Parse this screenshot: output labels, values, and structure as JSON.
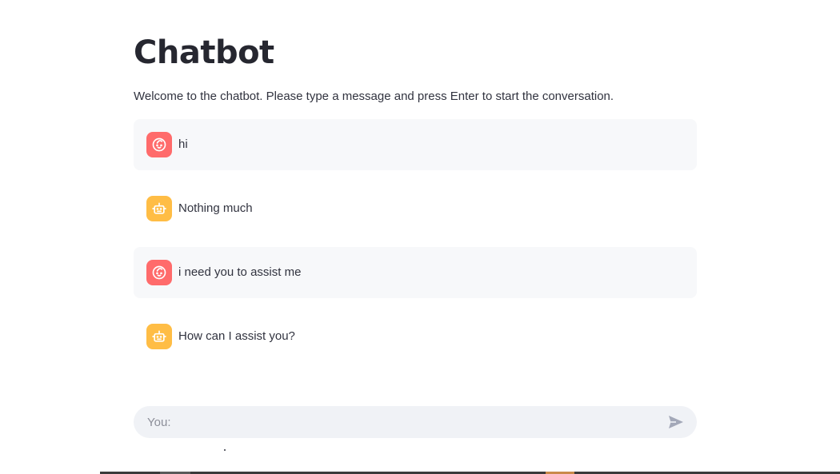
{
  "page": {
    "title": "Chatbot",
    "welcome": "Welcome to the chatbot. Please type a message and press Enter to start the conversation."
  },
  "messages": [
    {
      "role": "user",
      "text": "hi",
      "icon": "user-face-icon"
    },
    {
      "role": "assistant",
      "text": "Nothing much",
      "icon": "robot-icon"
    },
    {
      "role": "user",
      "text": "i need you to assist me",
      "icon": "user-face-icon"
    },
    {
      "role": "assistant",
      "text": "How can I assist you?",
      "icon": "robot-icon"
    }
  ],
  "chat_input": {
    "placeholder": "You:",
    "value": "",
    "send_icon": "send-icon"
  },
  "colors": {
    "user_avatar": "#ff6b6b",
    "assistant_avatar": "#ffbd45",
    "user_message_bg": "#f7f8fa",
    "input_bg": "#f0f2f6",
    "text": "#31333f",
    "title": "#262730"
  }
}
